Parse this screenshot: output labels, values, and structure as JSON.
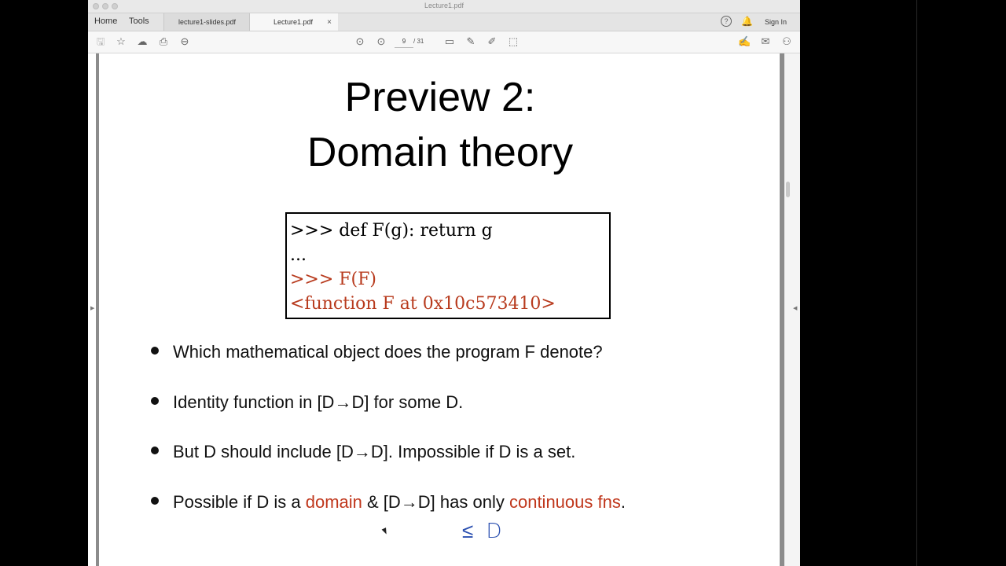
{
  "window": {
    "title": "Lecture1.pdf"
  },
  "nav": {
    "home": "Home",
    "tools": "Tools"
  },
  "tabs": [
    {
      "label": "lecture1-slides.pdf"
    },
    {
      "label": "Lecture1.pdf",
      "close": "×"
    }
  ],
  "header_right": {
    "sign_in": "Sign In"
  },
  "toolbar": {
    "current_page": "9",
    "total_pages": "/ 31"
  },
  "slide": {
    "title_line1": "Preview 2:",
    "title_line2": "Domain theory",
    "code": [
      {
        "text": ">>> def F(g): return g",
        "color": "#000000"
      },
      {
        "text": "...",
        "color": "#000000"
      },
      {
        "text": ">>> F(F)",
        "color": "#b83b1e"
      },
      {
        "text": "<function F at 0x10c573410>",
        "color": "#b83b1e"
      }
    ],
    "bullets": {
      "b1": "Which mathematical object does the program F denote?",
      "b2": "Identity function in [D→D] for some D.",
      "b3": "But D should include [D→D]. Impossible if D is a set.",
      "b4_part1": "Possible if D is a ",
      "b4_part2": "domain",
      "b4_part3": " & [D→D] has only ",
      "b4_part4": "continuous fns",
      "b4_part5": "."
    },
    "annotation": "≤ D",
    "accent_color": "#c0371c"
  }
}
